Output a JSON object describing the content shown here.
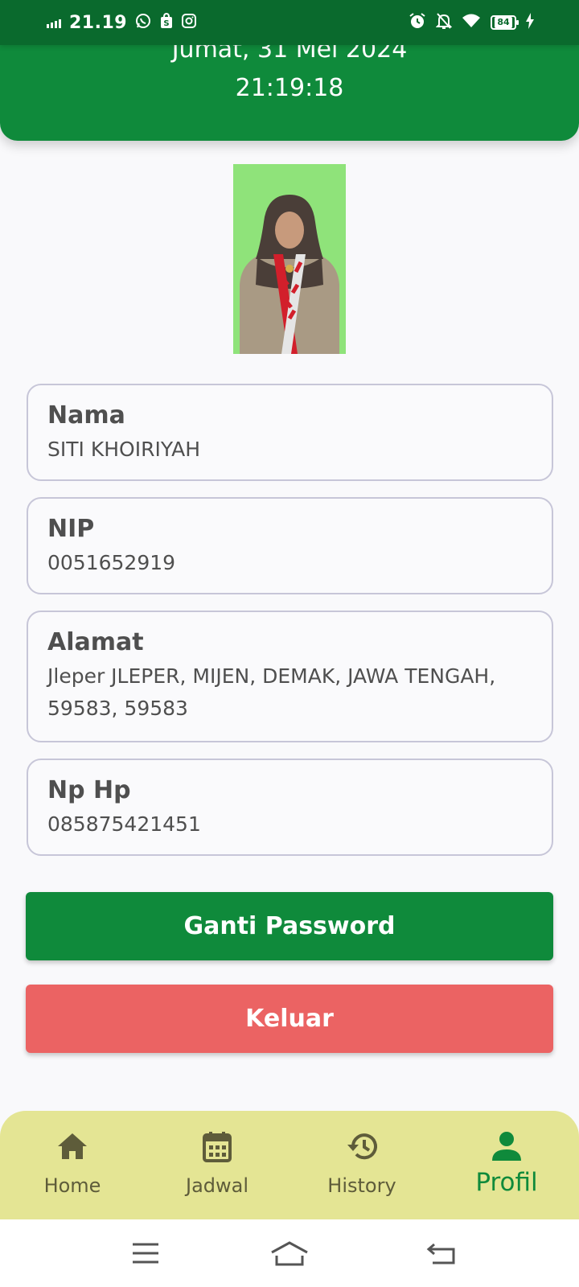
{
  "status_bar": {
    "time": "21.19",
    "battery": "84"
  },
  "header": {
    "date": "Jumat, 31 Mei 2024",
    "time": "21:19:18"
  },
  "profile": {
    "nama": {
      "label": "Nama",
      "value": "SITI KHOIRIYAH"
    },
    "nip": {
      "label": "NIP",
      "value": "0051652919"
    },
    "alamat": {
      "label": "Alamat",
      "value": "Jleper JLEPER, MIJEN, DEMAK, JAWA TENGAH, 59583, 59583"
    },
    "nohp": {
      "label": "Np Hp",
      "value": "085875421451"
    }
  },
  "buttons": {
    "change_password": "Ganti Password",
    "logout": "Keluar"
  },
  "bottom_nav": {
    "items": [
      {
        "label": "Home",
        "icon": "home-icon",
        "active": false
      },
      {
        "label": "Jadwal",
        "icon": "calendar-icon",
        "active": false
      },
      {
        "label": "History",
        "icon": "history-icon",
        "active": false
      },
      {
        "label": "Profil",
        "icon": "person-icon",
        "active": true
      }
    ]
  },
  "colors": {
    "primary_green": "#0f8a3b",
    "status_bar_green": "#0a6a2d",
    "logout_red": "#eb6363",
    "nav_background": "#e4e594",
    "nav_inactive": "#5e5c3a"
  }
}
